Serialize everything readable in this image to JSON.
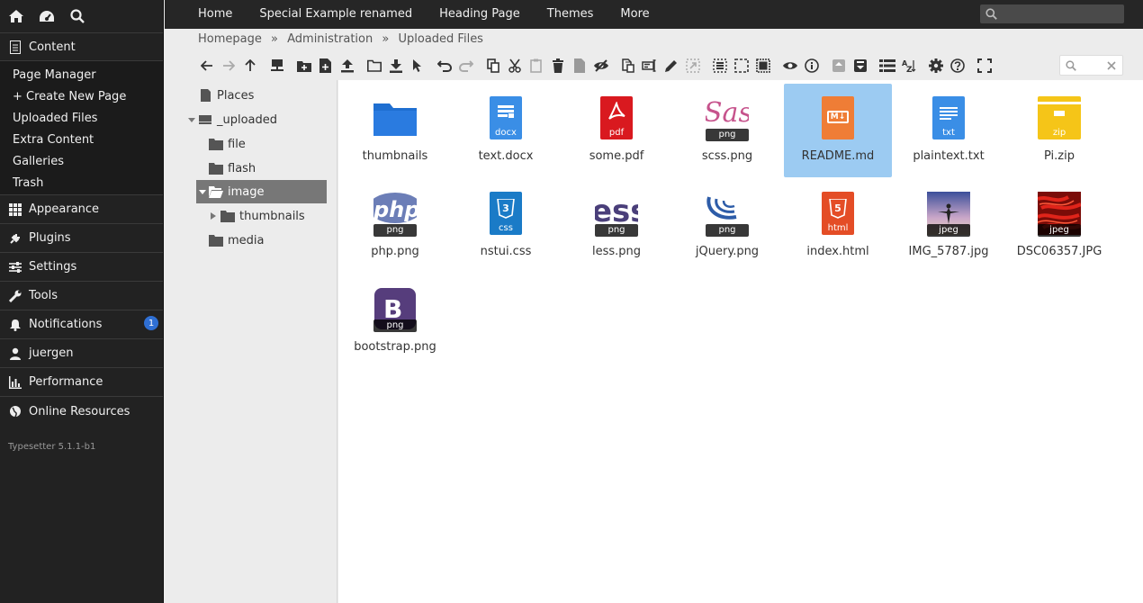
{
  "admin": {
    "top_icons": [
      "home-icon",
      "dashboard-icon",
      "search-icon"
    ],
    "content_label": "Content",
    "content_items": [
      {
        "label": "Page Manager"
      },
      {
        "label": "+ Create New Page"
      },
      {
        "label": "Uploaded Files"
      },
      {
        "label": "Extra Content"
      },
      {
        "label": "Galleries"
      },
      {
        "label": "Trash"
      }
    ],
    "sections": [
      {
        "label": "Appearance",
        "icon": "grid-icon"
      },
      {
        "label": "Plugins",
        "icon": "plug-icon"
      },
      {
        "label": "Settings",
        "icon": "sliders-icon"
      },
      {
        "label": "Tools",
        "icon": "wrench-icon"
      },
      {
        "label": "Notifications",
        "icon": "bell-icon",
        "badge": "1"
      },
      {
        "label": "juergen",
        "icon": "user-icon"
      },
      {
        "label": "Performance",
        "icon": "chart-icon"
      },
      {
        "label": "Online Resources",
        "icon": "globe-icon"
      }
    ],
    "version": "Typesetter 5.1.1-b1"
  },
  "menu": [
    "Home",
    "Special Example renamed",
    "Heading Page",
    "Themes",
    "More"
  ],
  "breadcrumb": [
    "Homepage",
    "»",
    "Administration",
    "»",
    "Uploaded Files"
  ],
  "tree": [
    {
      "label": "Places"
    },
    {
      "label": "_uploaded"
    },
    {
      "label": "file"
    },
    {
      "label": "flash"
    },
    {
      "label": "image"
    },
    {
      "label": "thumbnails"
    },
    {
      "label": "media"
    }
  ],
  "files": [
    {
      "name": "thumbnails",
      "kind": "folder",
      "color": "#1f6fd1"
    },
    {
      "name": "text.docx",
      "kind": "doc",
      "tag": "docx",
      "color": "#3a8ee6"
    },
    {
      "name": "some.pdf",
      "kind": "doc",
      "tag": "pdf",
      "color": "#d9191f"
    },
    {
      "name": "scss.png",
      "kind": "img",
      "tag": "png",
      "color": "#c6538c"
    },
    {
      "name": "README.md",
      "kind": "doc",
      "tag": "",
      "color": "#ef7d36"
    },
    {
      "name": "plaintext.txt",
      "kind": "doc",
      "tag": "txt",
      "color": "#3a8ee6"
    },
    {
      "name": "Pi.zip",
      "kind": "zip",
      "tag": "zip",
      "color": "#f5c518"
    },
    {
      "name": "php.png",
      "kind": "img",
      "tag": "png",
      "color": "#6c7eb7"
    },
    {
      "name": "nstui.css",
      "kind": "doc",
      "tag": "css",
      "color": "#1a7bc7"
    },
    {
      "name": "less.png",
      "kind": "img",
      "tag": "png",
      "color": "#2b4f84"
    },
    {
      "name": "jQuery.png",
      "kind": "img",
      "tag": "png",
      "color": "#2d5ca8"
    },
    {
      "name": "index.html",
      "kind": "doc",
      "tag": "html",
      "color": "#e44d26"
    },
    {
      "name": "IMG_5787.jpg",
      "kind": "photo",
      "tag": "jpeg",
      "color": "#5b6fa8"
    },
    {
      "name": "DSC06357.JPG",
      "kind": "photo",
      "tag": "jpeg",
      "color": "#b3130f"
    },
    {
      "name": "bootstrap.png",
      "kind": "img",
      "tag": "png",
      "color": "#563d7c"
    }
  ],
  "md_badge": "M↓",
  "css_badge": "3",
  "html_badge": "5"
}
